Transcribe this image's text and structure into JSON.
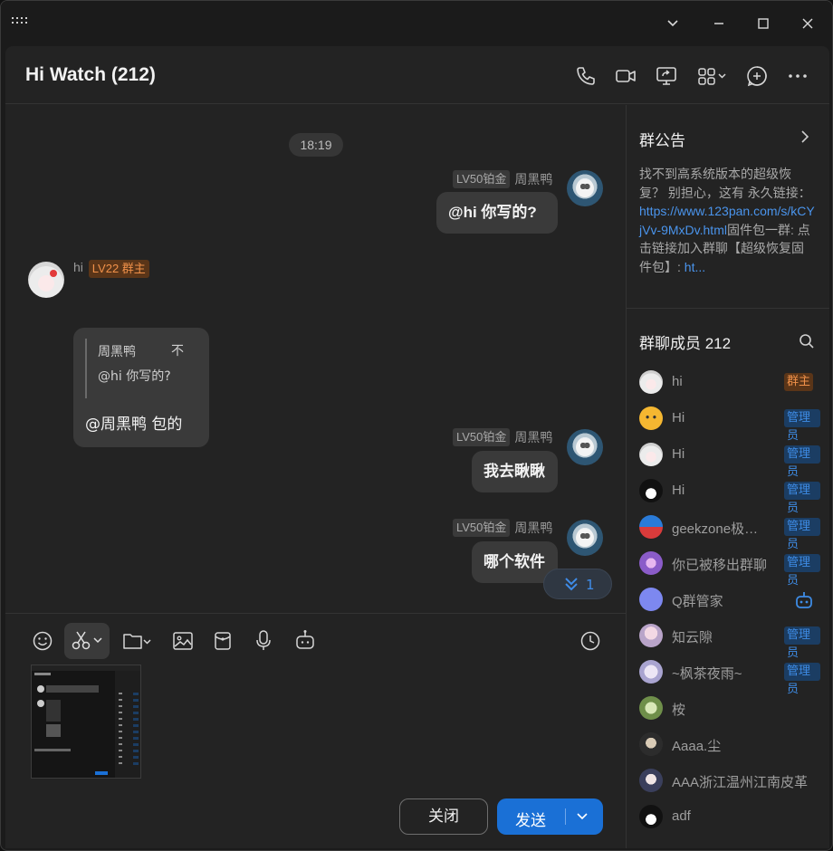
{
  "window": {
    "title_bar_icons": [
      "grid-menu-icon",
      "chevron-down-icon",
      "minimize-icon",
      "maximize-icon",
      "close-icon"
    ]
  },
  "chat": {
    "title": "Hi Watch (212)",
    "header_icons": [
      "phone-icon",
      "video-icon",
      "screen-share-icon",
      "apps-icon",
      "add-icon",
      "more-icon"
    ]
  },
  "messages": {
    "time": "18:19",
    "items": [
      {
        "level": "LV50铂金",
        "sender": "周黑鸭",
        "text": "@hi 你写的?",
        "side": "right"
      },
      {
        "sender": "hi",
        "level": "LV22 群主",
        "quote_name": "周黑鸭",
        "quote_close": "不",
        "quote_text": "@hi  你写的?",
        "text": "@周黑鸭 包的",
        "side": "left"
      },
      {
        "level": "LV50铂金",
        "sender": "周黑鸭",
        "text": "我去瞅瞅",
        "side": "right"
      },
      {
        "level": "LV50铂金",
        "sender": "周黑鸭",
        "text": "哪个软件",
        "side": "right"
      }
    ],
    "new_count": "1"
  },
  "compose": {
    "tools": [
      "emoji-icon",
      "scissors-icon",
      "folder-icon",
      "image-icon",
      "red-packet-icon",
      "microphone-icon",
      "robot-icon",
      "history-icon"
    ],
    "close_label": "关闭",
    "send_label": "发送"
  },
  "sidebar": {
    "announcement_title": "群公告",
    "announcement_text_1": "找不到高系统版本的超级恢复？ 别担心，这有 永久链接：",
    "announcement_link": "https://www.123pan.com/s/kCYjVv-9MxDv.html",
    "announcement_text_2": "固件包一群: 点击链接加入群聊【超级恢复固件包】: ",
    "announcement_link_2": "ht...",
    "members_title": "群聊成员 212",
    "members": [
      {
        "name": "hi",
        "badge": "群主",
        "badge_type": "owner",
        "avatar": "girl"
      },
      {
        "name": "Hi",
        "badge": "管理员",
        "badge_type": "admin",
        "avatar": "smile"
      },
      {
        "name": "Hi",
        "badge": "管理员",
        "badge_type": "admin",
        "avatar": "girl"
      },
      {
        "name": "Hi",
        "badge": "管理员",
        "badge_type": "admin",
        "avatar": "penguin"
      },
      {
        "name": "geekzone极客空间",
        "badge": "管理员",
        "badge_type": "admin",
        "avatar": "robot"
      },
      {
        "name": "你已被移出群聊",
        "badge": "管理员",
        "badge_type": "admin",
        "avatar": "purple"
      },
      {
        "name": "Q群管家",
        "badge": "",
        "badge_type": "bot",
        "avatar": "qbot"
      },
      {
        "name": "知云隙",
        "badge": "管理员",
        "badge_type": "admin",
        "avatar": "pink"
      },
      {
        "name": "~枫茶夜雨~",
        "badge": "管理员",
        "badge_type": "admin",
        "avatar": "lilac"
      },
      {
        "name": "桉",
        "badge": "",
        "badge_type": "",
        "avatar": "green"
      },
      {
        "name": "Aaaa.尘",
        "badge": "",
        "badge_type": "",
        "avatar": "dark"
      },
      {
        "name": "AAA浙江温州江南皮革",
        "badge": "",
        "badge_type": "",
        "avatar": "anime"
      },
      {
        "name": "adf",
        "badge": "",
        "badge_type": "",
        "avatar": "penguin"
      }
    ]
  }
}
